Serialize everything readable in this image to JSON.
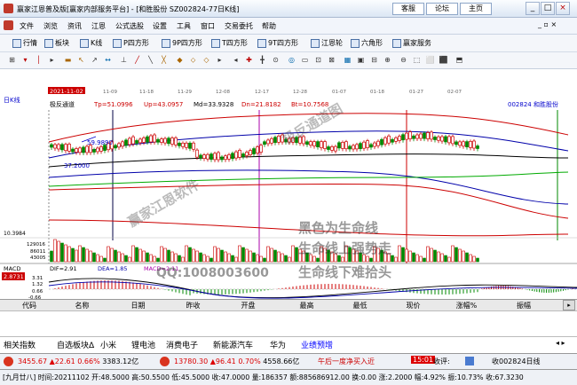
{
  "window": {
    "title": "赢家江恩普及版[赢家内部服务平台] - [和胜股份 SZ002824-77日K线]",
    "buttons": [
      "客服",
      "论坛",
      "主页"
    ],
    "controls": [
      "_",
      "□",
      "×"
    ]
  },
  "menu": [
    "文件",
    "浏览",
    "资讯",
    "江恩",
    "公式选股",
    "设置",
    "工具",
    "窗口",
    "交易委托",
    "帮助"
  ],
  "toolbar1": [
    "行情",
    "板块",
    "K线",
    "P四方形",
    "9P四方形",
    "T四方形",
    "9T四方形",
    "江恩轮",
    "六角形",
    "赢家服务"
  ],
  "chart": {
    "period_label": "日K线",
    "date_cursor": "2021-11-02",
    "channel_label": "极反通道",
    "tp": "Tp=51.0996",
    "up": "Up=43.0957",
    "md": "Md=33.9328",
    "dn": "Dn=21.8182",
    "bt": "Bt=10.7568",
    "stock": "002824  和胜股份",
    "price_high": "59.9890",
    "price_low": "37.2000",
    "axis_low": "10.3984",
    "vol_labels": [
      "129016",
      "86011",
      "43005"
    ],
    "macd_title": "MACD",
    "dif": "DIF=2.91",
    "dea": "DEA=1.85",
    "macd": "MACD=2.11",
    "macd_cursor": "2.8731",
    "macd_ticks": [
      "3.31",
      "1.32",
      "0.66",
      "-0.66"
    ],
    "date_ticks": [
      "11-09",
      "11-18",
      "11-29",
      "12-08",
      "12-17",
      "12-28",
      "01-07",
      "01-18",
      "01-27",
      "02-07"
    ]
  },
  "watermarks": {
    "wm1": "赢家江恩软件",
    "wm2": "极反通道图",
    "wm3": "黑色为生命线",
    "wm4": "生命线上强势走",
    "wm5": "生命线下难拾头",
    "wm6": "QQ:1008003600"
  },
  "columns": [
    "代码",
    "名称",
    "日期",
    "昨收",
    "开盘",
    "最高",
    "最低",
    "现价",
    "涨幅%",
    "振幅"
  ],
  "blocks": [
    "相关指数",
    "自选板块Δ",
    "小米",
    "锂电池",
    "消费电子",
    "新能源汽车",
    "华为",
    "业绩预增"
  ],
  "index_bar": {
    "sh": "3455.67",
    "sh_chg": "▲22.61",
    "sh_pct": "0.66%",
    "sh_amt": "3383.12亿",
    "sz": "13780.30",
    "sz_chg": "▲96.41",
    "sz_pct": "0.70%",
    "sz_amt": "4558.66亿",
    "news": "午后一度净买入近",
    "time": "15:01",
    "right_label": "收评:",
    "right_text": "收002824日线"
  },
  "status": "[九月廿八] 时间:20211102 开:48.5000 高:50.5500 低:45.5000 收:47.0000 量:186357 额:885686912.00 换:0.00 涨:2.2000 幅:4.92% 振:10.73% 收:67.3230"
}
